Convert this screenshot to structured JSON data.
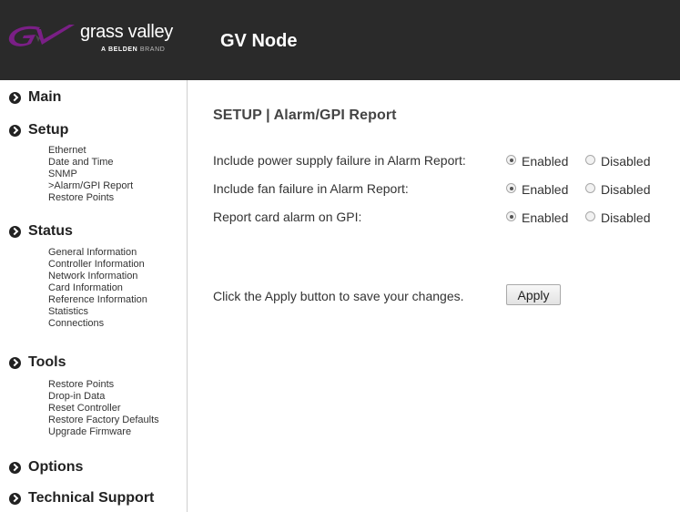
{
  "header": {
    "brand_name": "grass valley",
    "brand_tag_bold": "A BELDEN",
    "brand_tag_thin": "BRAND",
    "app_title": "GV Node",
    "background_color": "#2a2a2a"
  },
  "sidebar": {
    "main": {
      "label": "Main",
      "icon": "chevron-circle-right-icon"
    },
    "setup": {
      "label": "Setup",
      "icon": "chevron-circle-right-icon",
      "items": [
        "Ethernet",
        "Date and Time",
        "SNMP",
        ">Alarm/GPI Report",
        "Restore Points"
      ]
    },
    "status": {
      "label": "Status",
      "icon": "chevron-circle-right-icon",
      "items": [
        "General Information",
        "Controller Information",
        "Network Information",
        "Card Information",
        "Reference Information",
        "Statistics",
        "Connections"
      ]
    },
    "tools": {
      "label": "Tools",
      "icon": "chevron-circle-right-icon",
      "items": [
        "Restore Points",
        "Drop-in Data",
        "Reset Controller",
        "Restore Factory Defaults",
        "Upgrade Firmware"
      ]
    },
    "options": {
      "label": "Options",
      "icon": "chevron-circle-right-icon"
    },
    "support": {
      "label": "Technical Support",
      "icon": "chevron-circle-right-icon"
    }
  },
  "content": {
    "title": "SETUP | Alarm/GPI Report",
    "options": [
      {
        "label": "Include power supply failure in Alarm Report:",
        "enabled_label": "Enabled",
        "disabled_label": "Disabled",
        "selected": "Enabled"
      },
      {
        "label": "Include fan failure in Alarm Report:",
        "enabled_label": "Enabled",
        "disabled_label": "Disabled",
        "selected": "Enabled"
      },
      {
        "label": "Report card alarm on GPI:",
        "enabled_label": "Enabled",
        "disabled_label": "Disabled",
        "selected": "Enabled"
      }
    ],
    "apply_text": "Click the Apply button to save your changes.",
    "apply_button": "Apply"
  }
}
